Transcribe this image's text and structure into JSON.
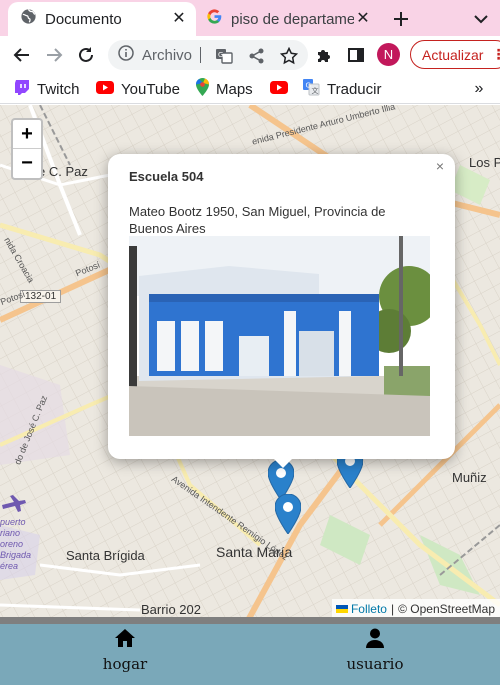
{
  "browser": {
    "tabs": [
      {
        "title": "Documento",
        "active": true
      },
      {
        "title": "piso de departame",
        "active": false
      }
    ],
    "omnibox": {
      "url_text": "Archivo"
    },
    "profile_initial": "N",
    "update_label": "Actualizar",
    "bookmarks": [
      {
        "label": "Twitch",
        "icon": "twitch-icon"
      },
      {
        "label": "YouTube",
        "icon": "youtube-icon"
      },
      {
        "label": "Maps",
        "icon": "maps-icon"
      },
      {
        "label": "",
        "icon": "youtube-icon"
      },
      {
        "label": "Traducir",
        "icon": "translate-icon"
      }
    ]
  },
  "map": {
    "zoom_in": "+",
    "zoom_out": "−",
    "labels": {
      "jose_c_paz": "e C. Paz",
      "los_polvorines": "Los P",
      "munez": "Muñiz",
      "santa_brigida": "Santa Brígida",
      "santa_maria": "Santa María",
      "barrio_202": "Barrio 202",
      "route_shield": "132-01",
      "road_potosi_1": "Potosí",
      "road_potosi_2": "Potosí",
      "road_croacia": "nida Croacia",
      "road_illia": "enida Presidente Arturo Umberto Illia",
      "road_remigio": "Avenida Intendente Remigio López",
      "road_jose_paz": "do de José C. Paz",
      "airport": "puerto riano oreno Brigada érea"
    },
    "popup": {
      "title": "Escuela 504",
      "address": "Mateo Bootz 1950, San Miguel, Provincia de Buenos Aires",
      "close": "×"
    },
    "attribution": {
      "leaflet": "Folleto",
      "separator": "|",
      "osm": "© OpenStreetMap"
    },
    "colors": {
      "marker": "#2a81cb",
      "popup_bg": "#ffffff"
    }
  },
  "bottom_nav": {
    "items": [
      {
        "label": "hogar",
        "icon": "home-icon"
      },
      {
        "label": "usuario",
        "icon": "user-icon"
      }
    ],
    "background": "#7aa8b9"
  }
}
